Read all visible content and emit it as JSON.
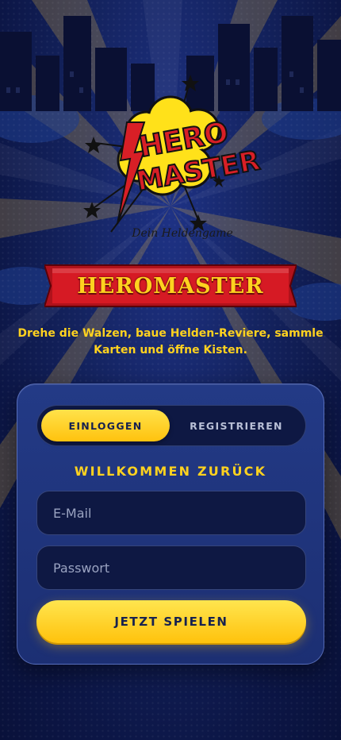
{
  "app": {
    "logo_text_line1": "HERO",
    "logo_text_line2": "MASTER",
    "tagline": "Dein Heldengame",
    "title": "HEROMASTER",
    "subtitle_line1": "Drehe die Walzen, baue Helden-Reviere, sammle",
    "subtitle_line2": "Karten und öffne Kisten."
  },
  "auth": {
    "tabs": [
      {
        "label": "EINLOGGEN",
        "active": true
      },
      {
        "label": "REGISTRIEREN",
        "active": false
      }
    ],
    "heading": "WILLKOMMEN ZURÜCK",
    "email": {
      "placeholder": "E-Mail",
      "value": ""
    },
    "password": {
      "placeholder": "Passwort",
      "value": ""
    },
    "submit_label": "JETZT SPIELEN"
  },
  "colors": {
    "accent_yellow": "#ffd21f",
    "banner_red": "#d11a24",
    "background_navy": "#14235f",
    "card_blue": "#233a86"
  }
}
